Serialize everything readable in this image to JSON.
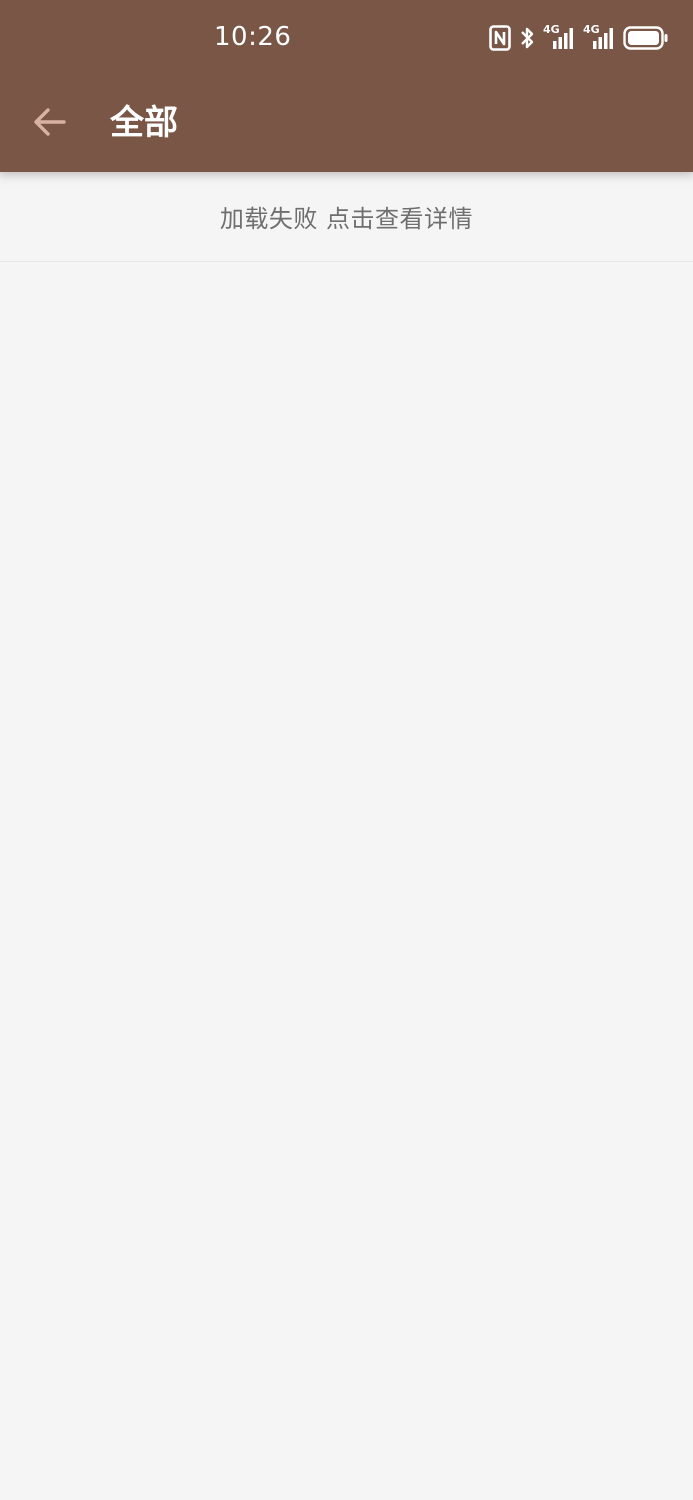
{
  "status_bar": {
    "time": "10:26",
    "icons": [
      "nfc-icon",
      "bluetooth-icon",
      "signal-4g-icon",
      "signal-4g-icon",
      "battery-icon"
    ],
    "signal_label_1": "4G",
    "signal_label_2": "4G"
  },
  "toolbar": {
    "back_icon": "arrow-left-icon",
    "title": "全部"
  },
  "content": {
    "error_message": "加载失败 点击查看详情"
  },
  "colors": {
    "app_bar": "#7a5647",
    "background": "#f5f5f5",
    "title_text": "#ffffff",
    "back_icon": "#d9b2a3",
    "error_text": "#6f6f6f"
  }
}
